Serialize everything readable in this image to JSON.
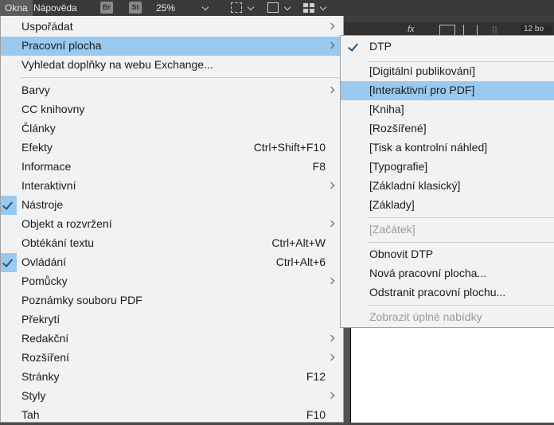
{
  "menubar": {
    "items": [
      "Okna",
      "Nápověda"
    ],
    "bridge_badge": "Br",
    "stock_badge": "St",
    "zoom": "25%"
  },
  "main_menu": {
    "items": [
      {
        "label": "Uspořádat",
        "shortcut": "",
        "submenu": true,
        "checked": false
      },
      {
        "label": "Pracovní plocha",
        "shortcut": "",
        "submenu": true,
        "checked": false,
        "highlighted": true
      },
      {
        "label": "Vyhledat doplňky na webu Exchange...",
        "shortcut": "",
        "submenu": false,
        "checked": false
      },
      {
        "label": "Barvy",
        "shortcut": "",
        "submenu": true,
        "checked": false
      },
      {
        "label": "CC knihovny",
        "shortcut": "",
        "submenu": false,
        "checked": false
      },
      {
        "label": "Články",
        "shortcut": "",
        "submenu": false,
        "checked": false
      },
      {
        "label": "Efekty",
        "shortcut": "Ctrl+Shift+F10",
        "submenu": false,
        "checked": false
      },
      {
        "label": "Informace",
        "shortcut": "F8",
        "submenu": false,
        "checked": false
      },
      {
        "label": "Interaktivní",
        "shortcut": "",
        "submenu": true,
        "checked": false
      },
      {
        "label": "Nástroje",
        "shortcut": "",
        "submenu": false,
        "checked": true
      },
      {
        "label": "Objekt a rozvržení",
        "shortcut": "",
        "submenu": true,
        "checked": false
      },
      {
        "label": "Obtékání textu",
        "shortcut": "Ctrl+Alt+W",
        "submenu": false,
        "checked": false
      },
      {
        "label": "Ovládání",
        "shortcut": "Ctrl+Alt+6",
        "submenu": false,
        "checked": true
      },
      {
        "label": "Pomůcky",
        "shortcut": "",
        "submenu": true,
        "checked": false
      },
      {
        "label": "Poznámky souboru PDF",
        "shortcut": "",
        "submenu": false,
        "checked": false
      },
      {
        "label": "Překrytí",
        "shortcut": "",
        "submenu": false,
        "checked": false
      },
      {
        "label": "Redakční",
        "shortcut": "",
        "submenu": true,
        "checked": false
      },
      {
        "label": "Rozšíření",
        "shortcut": "",
        "submenu": true,
        "checked": false
      },
      {
        "label": "Stránky",
        "shortcut": "F12",
        "submenu": false,
        "checked": false
      },
      {
        "label": "Styly",
        "shortcut": "",
        "submenu": true,
        "checked": false
      },
      {
        "label": "Tah",
        "shortcut": "F10",
        "submenu": false,
        "checked": false
      }
    ]
  },
  "workspace_submenu": {
    "items": [
      {
        "label": "DTP",
        "checked": true,
        "disabled": false
      },
      {
        "label": "[Digitální publikování]",
        "checked": false,
        "disabled": false
      },
      {
        "label": "[Interaktivní pro PDF]",
        "checked": false,
        "disabled": false,
        "highlighted": true
      },
      {
        "label": "[Kniha]",
        "checked": false,
        "disabled": false
      },
      {
        "label": "[Rozšířené]",
        "checked": false,
        "disabled": false
      },
      {
        "label": "[Tisk a kontrolní náhled]",
        "checked": false,
        "disabled": false
      },
      {
        "label": "[Typografie]",
        "checked": false,
        "disabled": false
      },
      {
        "label": "[Základní klasický]",
        "checked": false,
        "disabled": false
      },
      {
        "label": "[Základy]",
        "checked": false,
        "disabled": false
      },
      {
        "label": "[Začátek]",
        "checked": false,
        "disabled": true
      },
      {
        "label": "Obnovit DTP",
        "checked": false,
        "disabled": false
      },
      {
        "label": "Nová pracovní plocha...",
        "checked": false,
        "disabled": false
      },
      {
        "label": "Odstranit pracovní plochu...",
        "checked": false,
        "disabled": false
      },
      {
        "label": "Zobrazit úplné nabídky",
        "checked": false,
        "disabled": true
      }
    ]
  },
  "control_bar": {
    "fx_label": "fx",
    "pt_value": "12 bo"
  },
  "colors": {
    "menu_bg": "#f2f2f2",
    "highlight": "#99c9ef",
    "app_bg": "#3a3a3a"
  }
}
